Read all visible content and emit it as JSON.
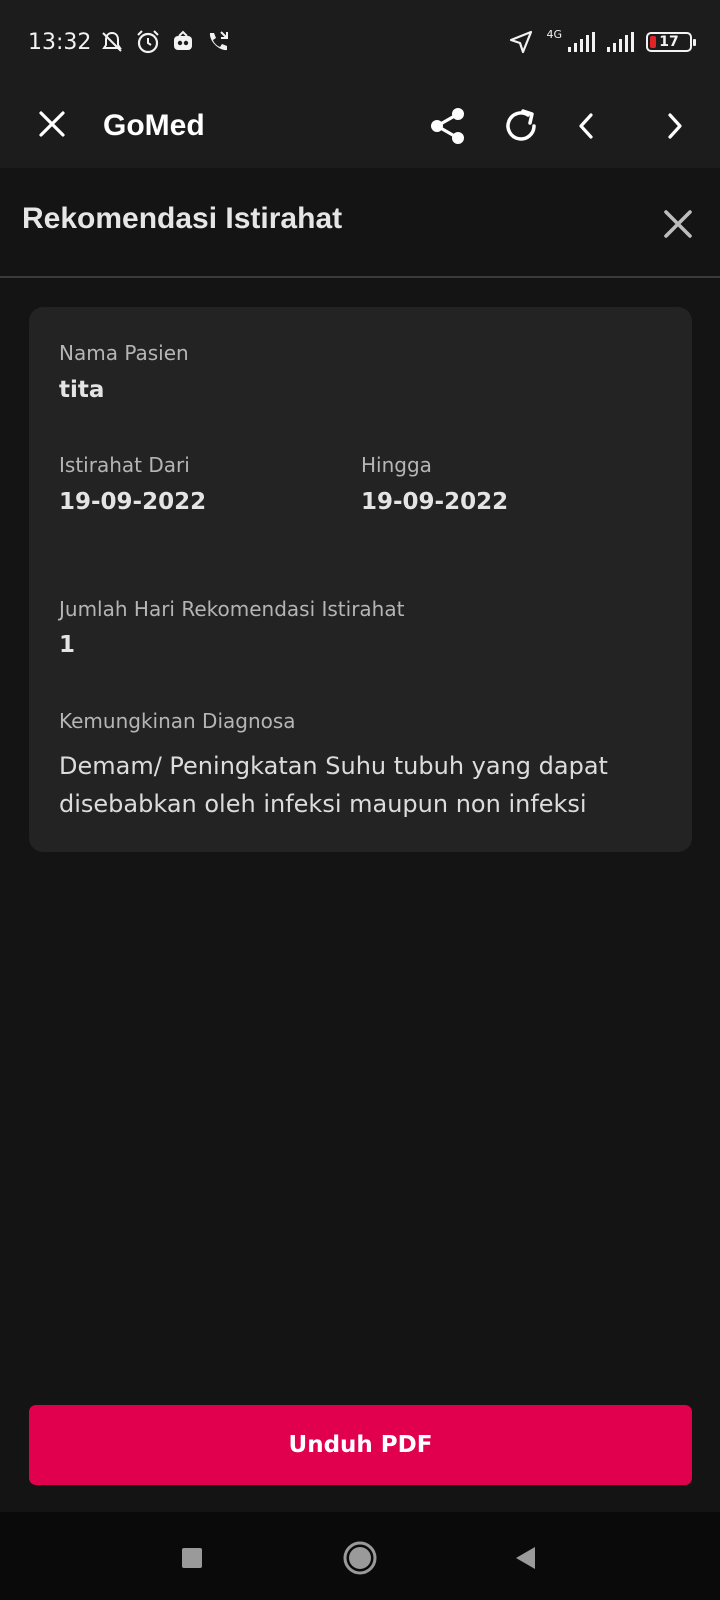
{
  "status_bar": {
    "time": "13:32",
    "network_label": "4G",
    "battery_level": "17",
    "icons": [
      "mute-icon",
      "alarm-icon",
      "app-notification-icon",
      "call-forward-icon",
      "location-icon",
      "signal-icon",
      "signal-icon",
      "battery-icon"
    ]
  },
  "toolbar": {
    "title": "GoMed",
    "icons": [
      "close-icon",
      "share-icon",
      "refresh-icon",
      "chevron-left-icon",
      "chevron-right-icon"
    ]
  },
  "page": {
    "title": "Rekomendasi Istirahat"
  },
  "card": {
    "patient_name_label": "Nama Pasien",
    "patient_name_value": "tita",
    "rest_from_label": "Istirahat Dari",
    "rest_from_value": "19-09-2022",
    "rest_until_label": "Hingga",
    "rest_until_value": "19-09-2022",
    "days_label": "Jumlah Hari Rekomendasi Istirahat",
    "days_value": "1",
    "diagnosis_label": "Kemungkinan Diagnosa",
    "diagnosis_value": "Demam/ Peningkatan Suhu tubuh yang dapat disebabkan oleh infeksi maupun non infeksi"
  },
  "actions": {
    "download_label": "Unduh PDF"
  },
  "colors": {
    "accent": "#e0004d",
    "background": "#141414",
    "card": "#232323",
    "battery_low": "#e0242a"
  }
}
